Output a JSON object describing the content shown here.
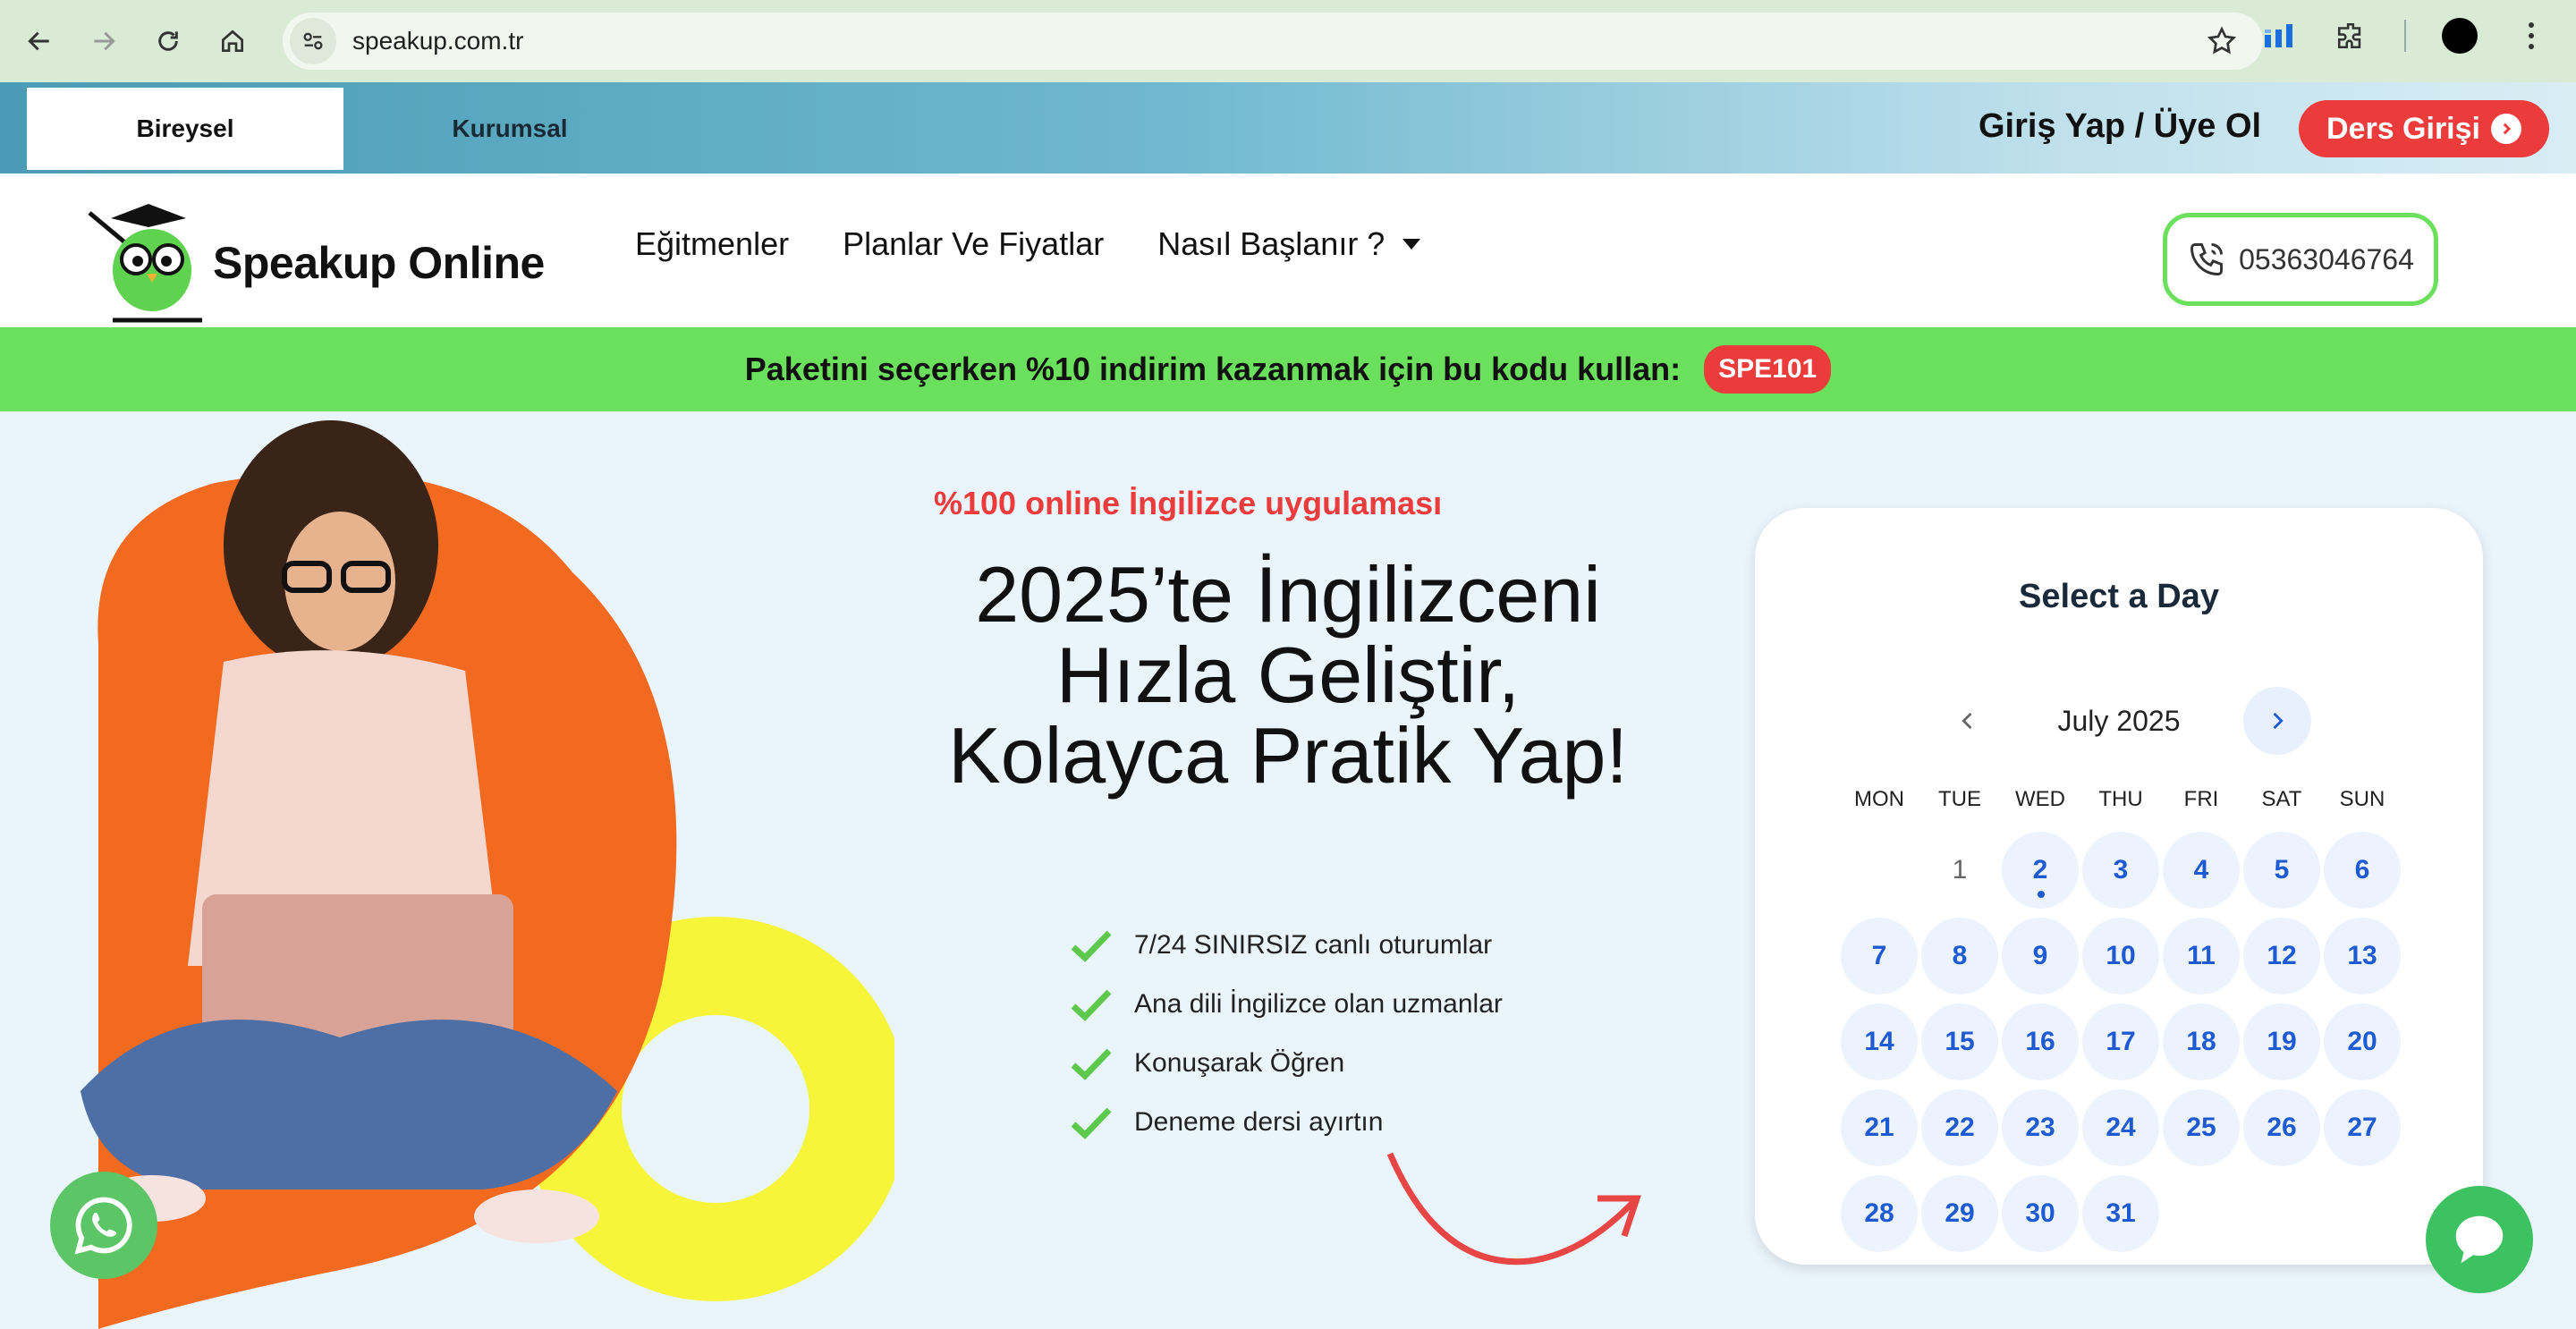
{
  "browser": {
    "url": "speakup.com.tr"
  },
  "topbar": {
    "tab_individual": "Bireysel",
    "tab_corporate": "Kurumsal",
    "login_label": "Giriş Yap / Üye Ol",
    "lesson_login_label": "Ders Girişi"
  },
  "header": {
    "logo_text": "Speakup Online",
    "menu": {
      "instructors": "Eğitmenler",
      "plans": "Planlar Ve Fiyatlar",
      "how_to_start": "Nasıl Başlanır ?"
    },
    "phone": "05363046764"
  },
  "promo": {
    "text": "Paketini seçerken %10 indirim kazanmak için bu kodu kullan:",
    "code": "SPE101"
  },
  "hero": {
    "subtitle": "%100 online İngilizce uygulaması",
    "title": "2025’te İngilizceni Hızla Geliştir, Kolayca Pratik Yap!",
    "features": [
      "7/24 SINIRSIZ canlı oturumlar",
      "Ana dili İngilizce olan uzmanlar",
      "Konuşarak Öğren",
      "Deneme dersi ayırtın"
    ]
  },
  "calendar": {
    "title": "Select a Day",
    "month_label": "July 2025",
    "weekdays": [
      "MON",
      "TUE",
      "WED",
      "THU",
      "FRI",
      "SAT",
      "SUN"
    ],
    "past_day": "1",
    "today": "2",
    "available_days": [
      "2",
      "3",
      "4",
      "5",
      "6",
      "7",
      "8",
      "9",
      "10",
      "11",
      "12",
      "13",
      "14",
      "15",
      "16",
      "17",
      "18",
      "19",
      "20",
      "21",
      "22",
      "23",
      "24",
      "25",
      "26",
      "27",
      "28",
      "29",
      "30",
      "31"
    ]
  },
  "colors": {
    "brand_green": "#6be05c",
    "brand_red": "#ec3b3b",
    "calendar_blue": "#1e5ad2",
    "hero_orange": "#f26a1f",
    "hero_yellow": "#f7f53a"
  }
}
